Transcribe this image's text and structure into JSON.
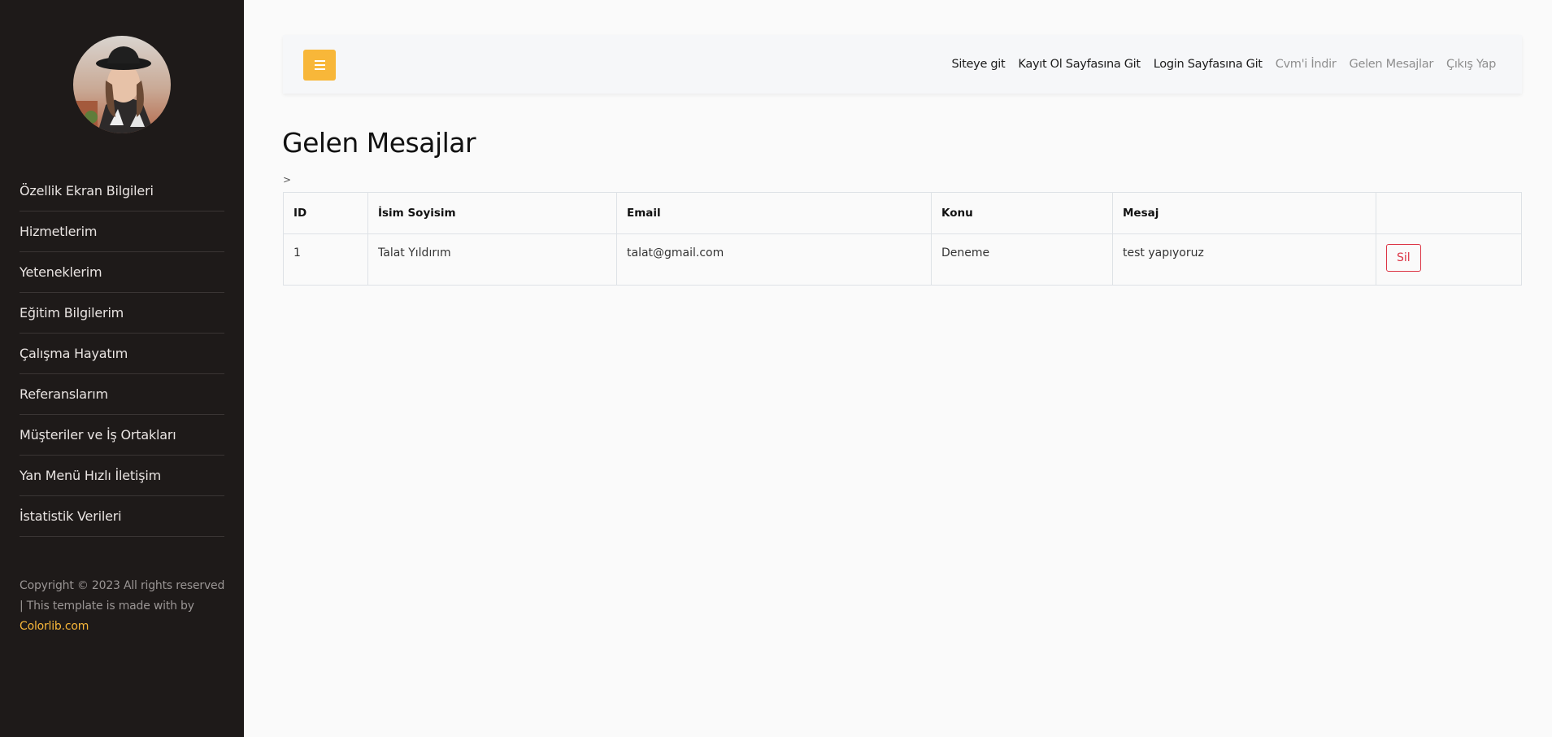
{
  "sidebar": {
    "items": [
      {
        "label": "Özellik Ekran Bilgileri"
      },
      {
        "label": "Hizmetlerim"
      },
      {
        "label": "Yeteneklerim"
      },
      {
        "label": "Eğitim Bilgilerim"
      },
      {
        "label": "Çalışma Hayatım"
      },
      {
        "label": "Referanslarım"
      },
      {
        "label": "Müşteriler ve İş Ortakları"
      },
      {
        "label": "Yan Menü Hızlı İletişim"
      },
      {
        "label": "İstatistik Verileri"
      }
    ],
    "copyright_text": "Copyright © 2023 All rights reserved | This template is made with by",
    "copyright_link": "Colorlib.com"
  },
  "topbar": {
    "menu_icon": "hamburger-icon",
    "links": [
      {
        "label": "Siteye git"
      },
      {
        "label": "Kayıt Ol Sayfasına Git"
      },
      {
        "label": "Login Sayfasına Git"
      },
      {
        "label": "Cvm'i İndir"
      },
      {
        "label": "Gelen Mesajlar"
      },
      {
        "label": "Çıkış Yap"
      }
    ]
  },
  "main": {
    "title": "Gelen Mesajlar",
    "breadcrumb": ">",
    "table": {
      "headers": [
        "ID",
        "İsim Soyisim",
        "Email",
        "Konu",
        "Mesaj",
        ""
      ],
      "rows": [
        {
          "id": "1",
          "name": "Talat Yıldırım",
          "email": "talat@gmail.com",
          "subject": "Deneme",
          "message": "test yapıyoruz",
          "action": "Sil"
        }
      ]
    }
  },
  "colors": {
    "sidebar_bg": "#1e1a19",
    "accent": "#f8b739",
    "danger": "#dc3545"
  }
}
